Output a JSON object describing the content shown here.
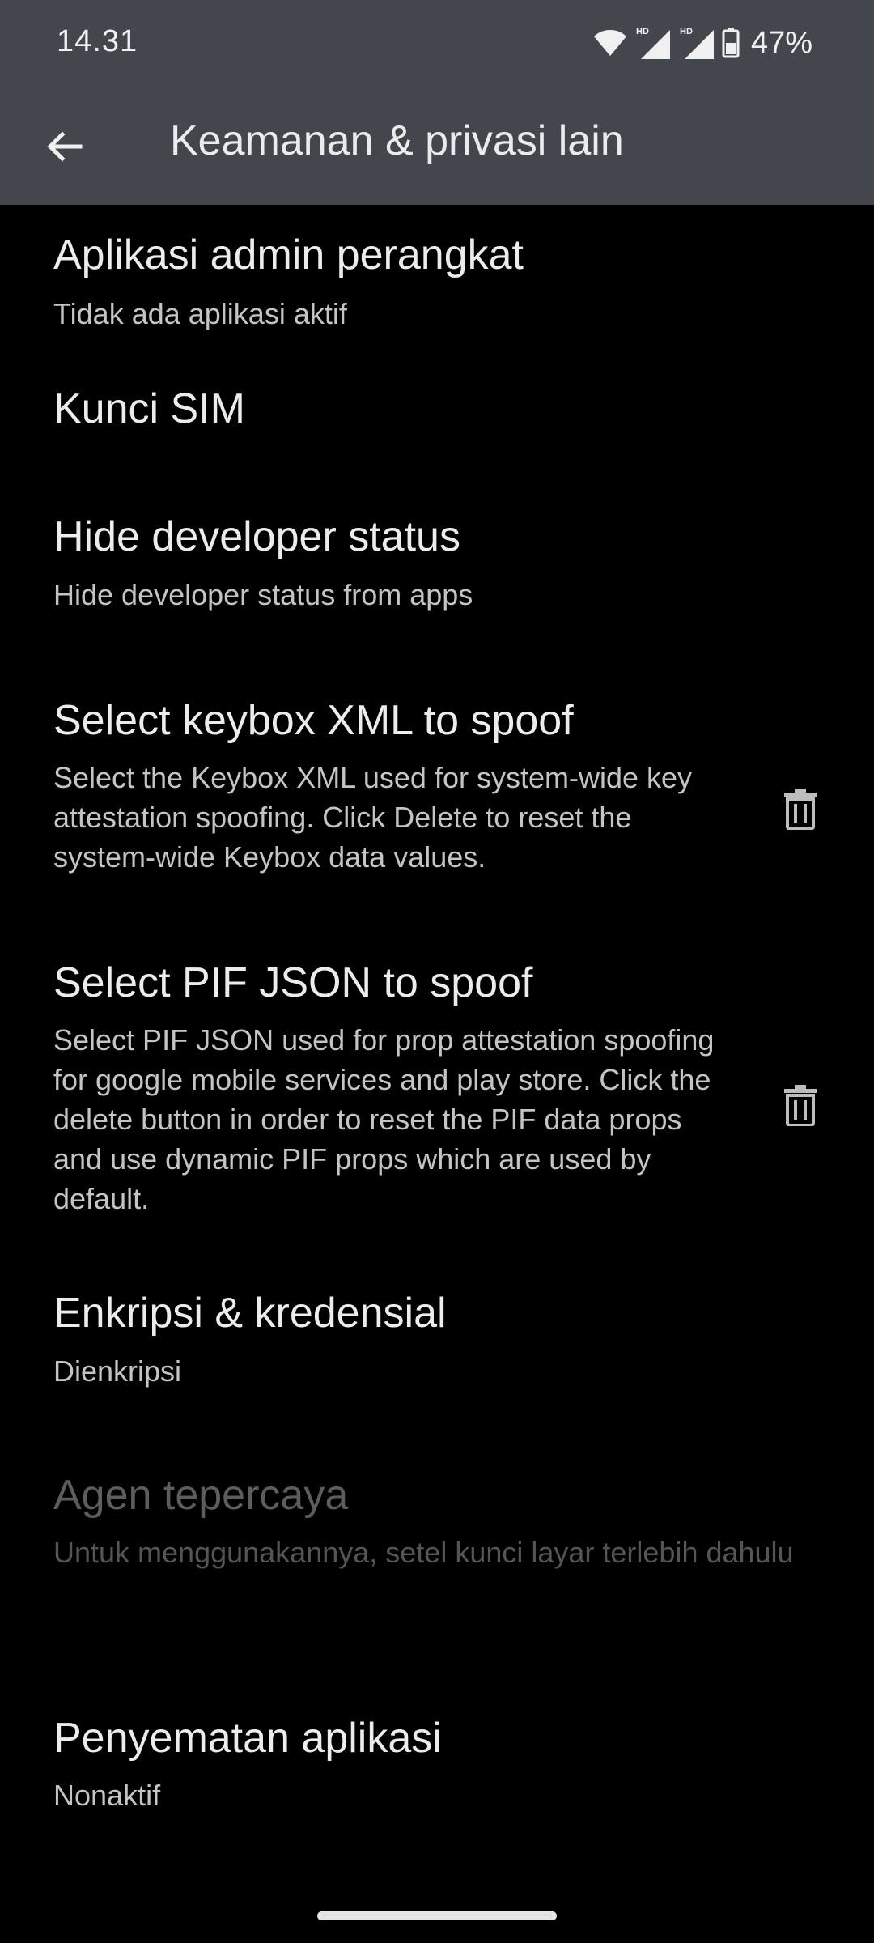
{
  "status_bar": {
    "time": "14.31",
    "battery_percent": "47%",
    "hd_label": "HD",
    "icons": [
      "wifi-icon",
      "signal-icon",
      "signal-icon",
      "battery-icon"
    ]
  },
  "app_bar": {
    "title": "Keamanan & privasi lain",
    "back_icon": "arrow-back-icon"
  },
  "settings": {
    "items": [
      {
        "title": "Aplikasi admin perangkat",
        "subtitle": "Tidak ada aplikasi aktif"
      },
      {
        "title": "Kunci SIM"
      },
      {
        "title": "Hide developer status",
        "subtitle": "Hide developer status from apps"
      },
      {
        "title": "Select keybox XML to spoof",
        "subtitle": "Select the Keybox XML used for system-wide key attestation spoofing. Click Delete to reset the system-wide Keybox data values.",
        "action_icon": "trash-icon"
      },
      {
        "title": "Select PIF JSON to spoof",
        "subtitle": "Select PIF JSON used for prop attestation spoofing for google mobile services and play store. Click the delete button in order to reset the PIF data props and use dynamic PIF props which are used by default.",
        "action_icon": "trash-icon"
      },
      {
        "title": "Enkripsi & kredensial",
        "subtitle": "Dienkripsi"
      },
      {
        "title": "Agen tepercaya",
        "subtitle": "Untuk menggunakannya, setel kunci layar terlebih dahulu",
        "enabled": false
      },
      {
        "title": "Penyematan aplikasi",
        "subtitle": "Nonaktif"
      }
    ]
  },
  "colors": {
    "app_bar_background": "#43474d",
    "screen_background": "#000000",
    "primary_text": "#ececec",
    "secondary_text": "#c4c4c4",
    "disabled_text": "#5d5d5d"
  }
}
